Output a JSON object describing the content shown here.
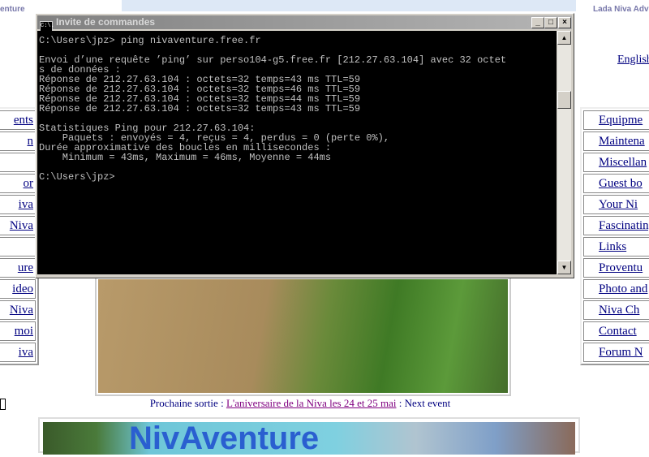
{
  "site": {
    "title_left": "enture",
    "title_right": "Lada Niva Adv",
    "english_link": "English"
  },
  "left_nav": [
    "ents",
    "n",
    "",
    "or",
    "iva",
    "Niva",
    "",
    "ure",
    "ideo",
    "Niva",
    "moi",
    "iva"
  ],
  "right_nav": [
    "Equipme",
    "Maintena",
    "Miscellan",
    "Guest bo",
    "Your Ni",
    "Fascinating",
    "Links",
    "Proventu",
    "Photo and",
    "Niva Ch",
    "Contact",
    "Forum N"
  ],
  "next_event": {
    "prefix": "Prochaine sortie : ",
    "link": "L'aniversaire de la Niva les 24 et 25 mai",
    "suffix": " : Next event"
  },
  "banner": {
    "logo": "NivAventure"
  },
  "cmd": {
    "title": "Invite de commandes",
    "icon_text": "C:\\.",
    "minimize": "_",
    "maximize": "□",
    "close": "×",
    "lines": [
      "C:\\Users\\jpz> ping nivaventure.free.fr",
      "",
      "Envoi d’une requête ’ping’ sur perso104-g5.free.fr [212.27.63.104] avec 32 octet",
      "s de données :",
      "Réponse de 212.27.63.104 : octets=32 temps=43 ms TTL=59",
      "Réponse de 212.27.63.104 : octets=32 temps=46 ms TTL=59",
      "Réponse de 212.27.63.104 : octets=32 temps=44 ms TTL=59",
      "Réponse de 212.27.63.104 : octets=32 temps=43 ms TTL=59",
      "",
      "Statistiques Ping pour 212.27.63.104:",
      "    Paquets : envoyés = 4, reçus = 4, perdus = 0 (perte 0%),",
      "Durée approximative des boucles en millisecondes :",
      "    Minimum = 43ms, Maximum = 46ms, Moyenne = 44ms",
      "",
      "C:\\Users\\jpz>"
    ]
  }
}
